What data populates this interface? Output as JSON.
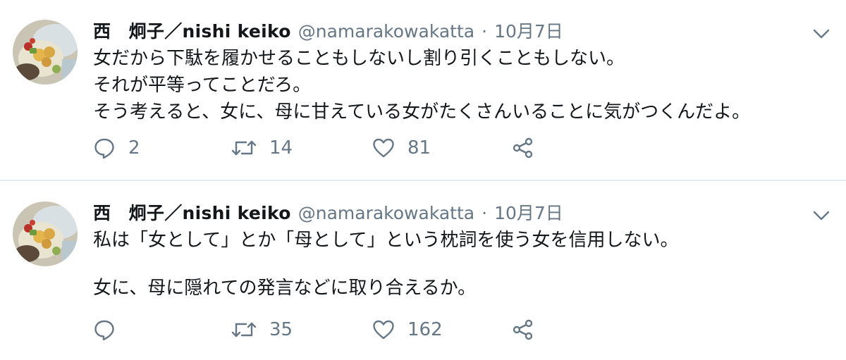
{
  "tweets": [
    {
      "author": {
        "display_name": "西　炯子／nishi keiko",
        "handle": "@namarakowakatta"
      },
      "separator": "·",
      "date": "10月7日",
      "text_lines": [
        "女だから下駄を履かせることもしないし割り引くこともしない。",
        "それが平等ってことだろ。",
        "そう考えると、女に、母に甘えている女がたくさんいることに気がつくんだよ。"
      ],
      "actions": {
        "reply_icon": "reply-bubble-icon",
        "reply_count": "2",
        "retweet_icon": "retweet-icon",
        "retweet_count": "14",
        "like_icon": "heart-icon",
        "like_count": "81",
        "share_icon": "share-icon"
      }
    },
    {
      "author": {
        "display_name": "西　炯子／nishi keiko",
        "handle": "@namarakowakatta"
      },
      "separator": "·",
      "date": "10月7日",
      "text_lines": [
        "私は「女として」とか「母として」という枕詞を使う女を信用しない。",
        "",
        "女に、母に隠れての発言などに取り合えるか。"
      ],
      "actions": {
        "reply_icon": "reply-bubble-icon",
        "reply_count": "",
        "retweet_icon": "retweet-icon",
        "retweet_count": "35",
        "like_icon": "heart-icon",
        "like_count": "162",
        "share_icon": "share-icon"
      }
    }
  ],
  "colors": {
    "text_primary": "#14171a",
    "text_secondary": "#657786",
    "divider": "#e6ecf0"
  }
}
